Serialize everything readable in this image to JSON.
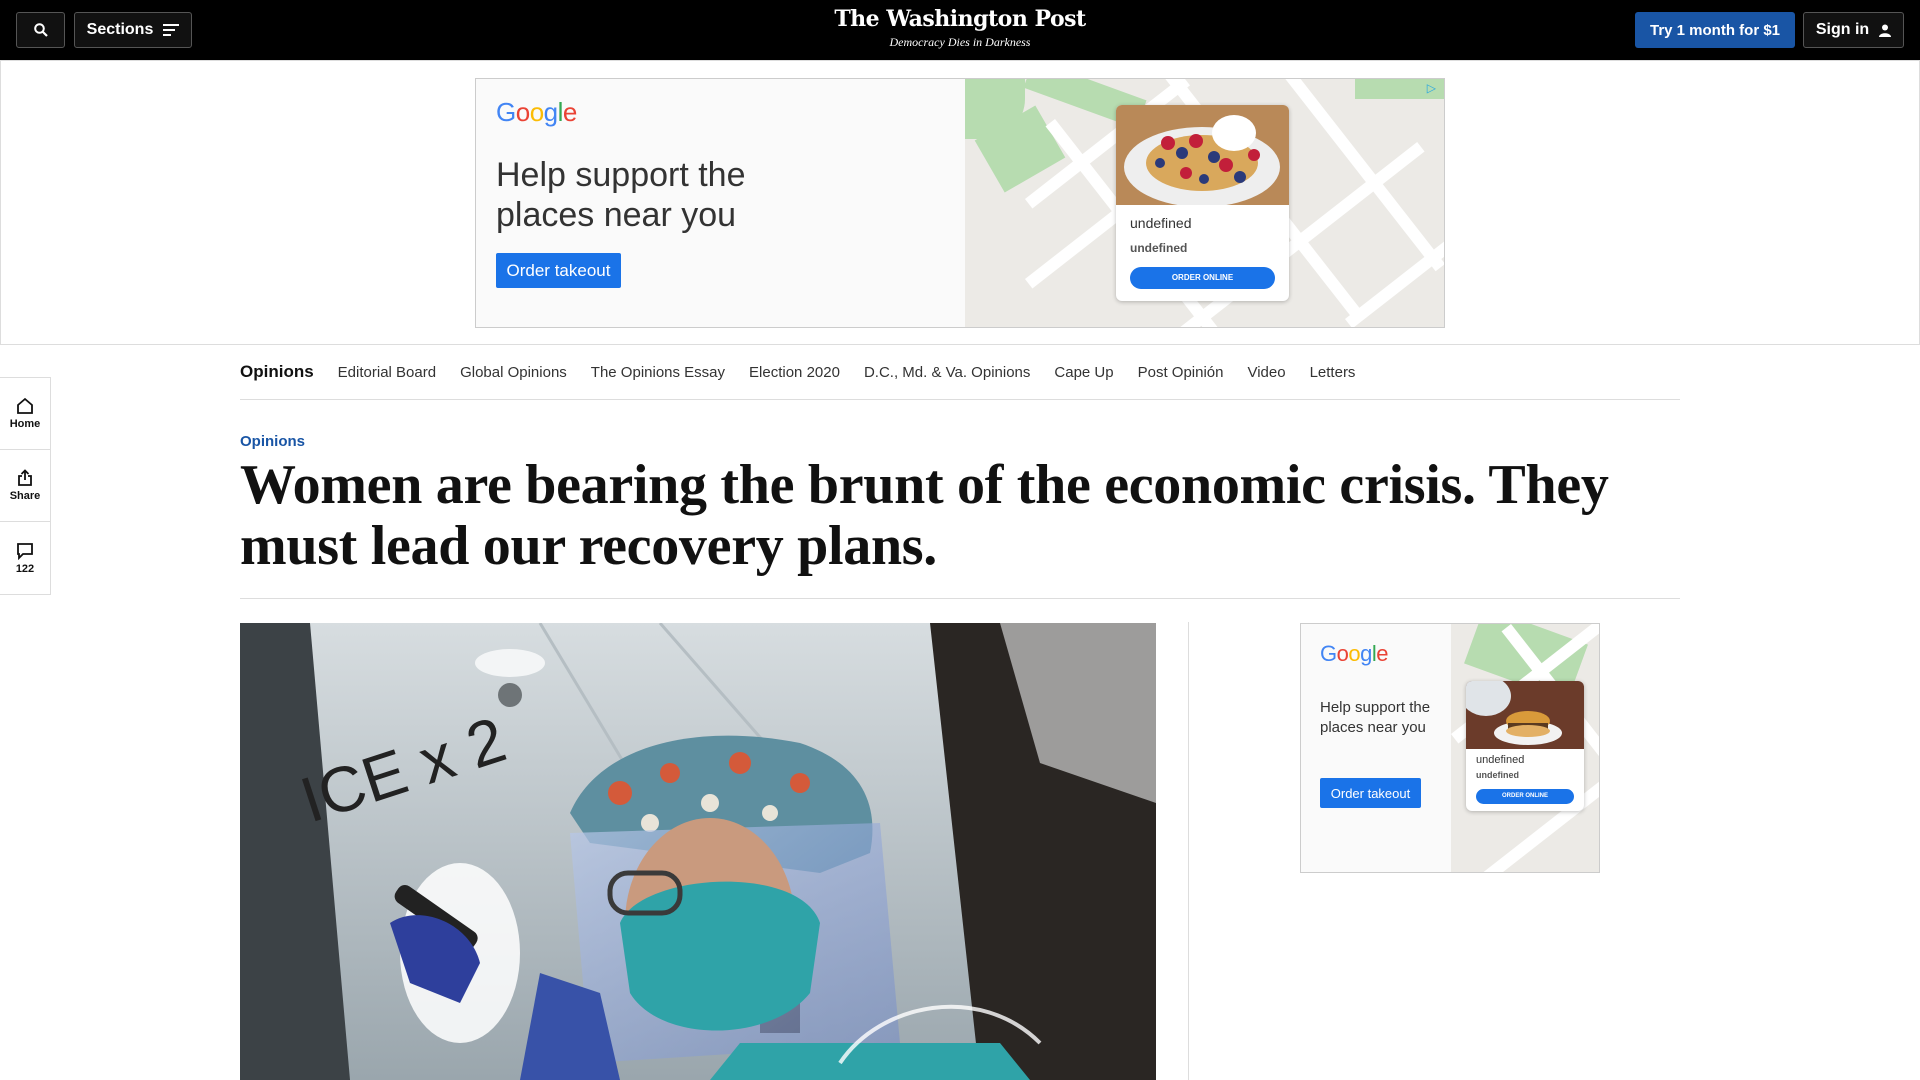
{
  "header": {
    "search_icon": "search-icon",
    "sections_label": "Sections",
    "logo_name": "The Washington Post",
    "logo_tagline": "Democracy Dies in Darkness",
    "try_label": "Try 1 month for $1",
    "signin_label": "Sign in"
  },
  "ad_top": {
    "brand": "Google",
    "headline": "Help support the places near you",
    "cta": "Order takeout",
    "card_name": "undefined",
    "card_sub": "undefined",
    "card_button": "ORDER ONLINE"
  },
  "rail": {
    "home_label": "Home",
    "share_label": "Share",
    "comments_count": "122"
  },
  "section_nav": {
    "items": [
      "Opinions",
      "Editorial Board",
      "Global Opinions",
      "The Opinions Essay",
      "Election 2020",
      "D.C., Md. & Va. Opinions",
      "Cape Up",
      "Post Opinión",
      "Video",
      "Letters"
    ]
  },
  "article": {
    "kicker": "Opinions",
    "headline": "Women are bearing the brunt of the economic crisis. They must lead our recovery plans."
  },
  "hero_image": {
    "glass_writing": "ICE x 2"
  },
  "ad_side": {
    "brand": "Google",
    "headline": "Help support the places near you",
    "cta": "Order takeout",
    "card_name": "undefined",
    "card_sub": "undefined",
    "card_button": "ORDER ONLINE"
  },
  "colors": {
    "header_bg": "#000000",
    "subscribe_blue": "#1955a5",
    "kicker_blue": "#1955a5",
    "ad_button_blue": "#1a73e8"
  }
}
